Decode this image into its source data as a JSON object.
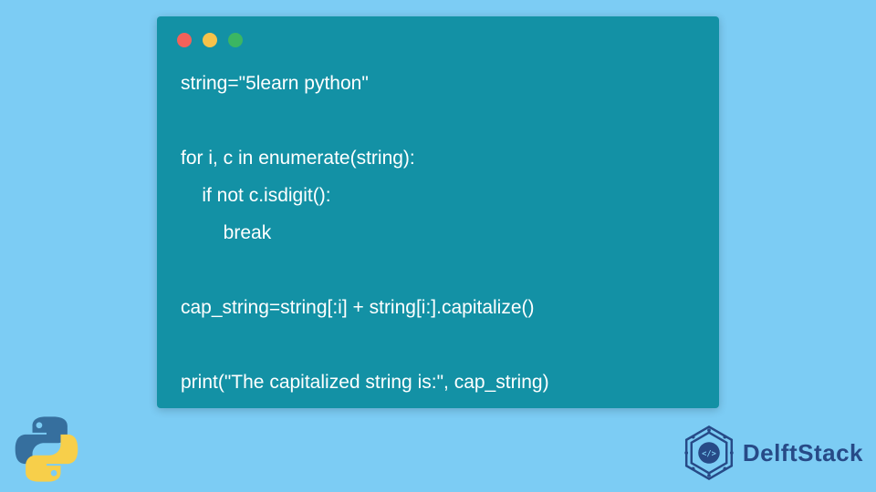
{
  "window": {
    "dot_colors": {
      "red": "#f3615a",
      "yellow": "#f7c24a",
      "green": "#3bb662"
    }
  },
  "code": {
    "lines": [
      "string=\"5learn python\"",
      "",
      "for i, c in enumerate(string):",
      "    if not c.isdigit():",
      "        break",
      "",
      "cap_string=string[:i] + string[i:].capitalize()",
      "",
      "print(\"The capitalized string is:\", cap_string)"
    ]
  },
  "branding": {
    "delftstack_label": "DelftStack",
    "delftstack_color": "#274a87"
  },
  "icons": {
    "python": "python-icon",
    "delftstack_badge": "delftstack-badge-icon"
  },
  "colors": {
    "background": "#7cccf4",
    "code_bg": "#1391a5",
    "code_text": "#ffffff"
  }
}
